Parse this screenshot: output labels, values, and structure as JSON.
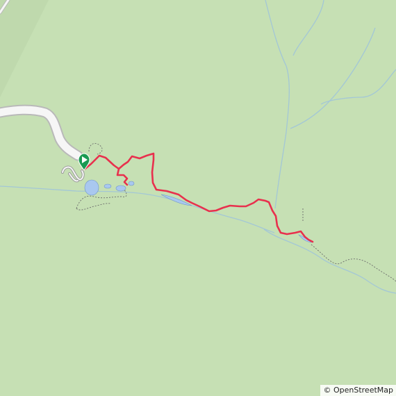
{
  "map": {
    "colors": {
      "land": "#c6e0b4",
      "road_fill": "#f6f6f6",
      "road_casing": "#b9b9b9",
      "water": "#a9c8ef",
      "water_edge": "#6f95c8",
      "stream": "#a3c7d6",
      "path_dash": "#6b6b6b",
      "route": "#e8304d",
      "start_marker": "#1a9a52"
    },
    "start_marker_icon": "play-triangle-icon",
    "route_name": "",
    "attribution": {
      "symbol": "©",
      "text": "OpenStreetMap"
    }
  }
}
